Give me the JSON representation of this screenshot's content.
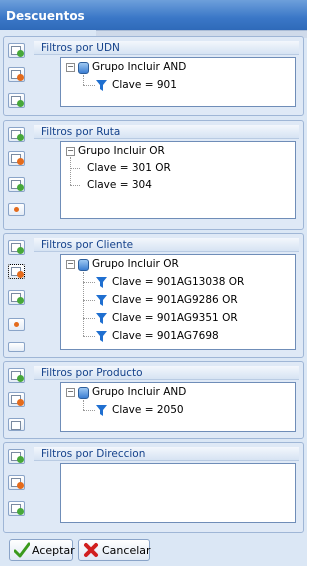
{
  "window": {
    "title": "Descuentos"
  },
  "sections": [
    {
      "header": "Filtros por UDN",
      "tree": {
        "group": "Grupo Incluir AND",
        "children": [
          "Clave = 901"
        ]
      }
    },
    {
      "header": "Filtros por Ruta",
      "tree": {
        "group": "Grupo Incluir OR",
        "children": [
          "Clave = 301 OR",
          "Clave = 304"
        ]
      }
    },
    {
      "header": "Filtros por Cliente",
      "tree": {
        "group": "Grupo Incluir OR",
        "children": [
          "Clave = 901AG13038 OR",
          "Clave = 901AG9286 OR",
          "Clave = 901AG9351 OR",
          "Clave = 901AG7698"
        ]
      }
    },
    {
      "header": "Filtros por Producto",
      "tree": {
        "group": "Grupo Incluir AND",
        "children": [
          "Clave = 2050"
        ]
      }
    },
    {
      "header": "Filtros por Direccion",
      "tree": null
    }
  ],
  "buttons": {
    "accept_label": "Aceptar",
    "cancel_label": "Cancelar"
  },
  "icons": {
    "accept": "check-icon",
    "cancel": "x-icon",
    "group": "database-icon",
    "filter": "funnel-icon",
    "add": "add-filter-icon",
    "remove": "remove-filter-icon",
    "edit": "edit-filter-icon"
  },
  "colors": {
    "title_bar": "#3a77c7",
    "header_text": "#15428b",
    "funnel": "#1f6fd0",
    "cancel_x": "#d11f1f",
    "accept_check": "#3a9a1c"
  }
}
